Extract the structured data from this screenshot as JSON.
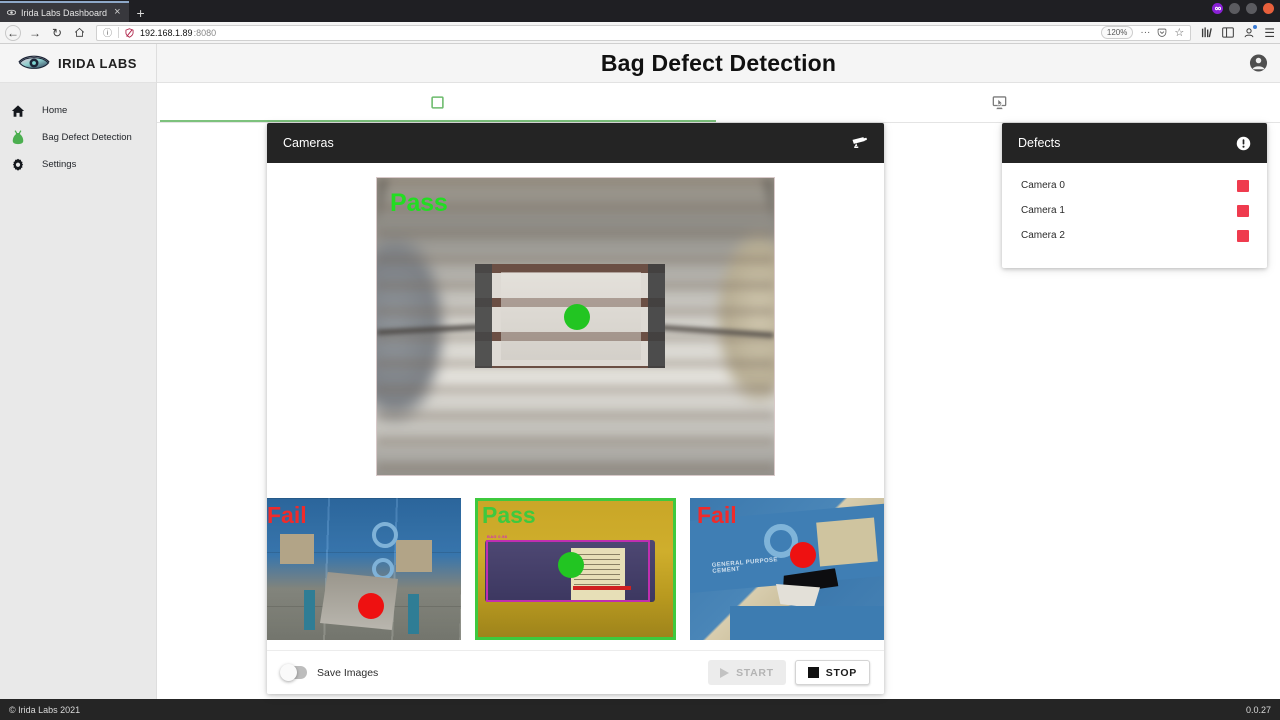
{
  "browser": {
    "tab": {
      "title": "Irida Labs Dashboard",
      "favicon": "irida-eye-favicon",
      "close": "×"
    },
    "new_tab_label": "+",
    "nav": {
      "back": "←",
      "forward": "→",
      "reload": "↻",
      "home": "⌂"
    },
    "url": {
      "host": "192.168.1.89",
      "port": ":8080",
      "shield": "ⓘ",
      "tracker": "tracking-protection-icon"
    },
    "zoom_level": "120%",
    "url_actions": {
      "more": "···",
      "pocket": "pocket-icon",
      "bookmark": "☆"
    },
    "toolbar_icons": {
      "library": "library-icon",
      "sidebar": "sidebar-icon",
      "account": "account-icon",
      "menu": "☰"
    },
    "window_controls": {
      "profile": "profile-avatar",
      "minimize": "minimize",
      "maximize": "maximize",
      "close": "close"
    }
  },
  "sidebar": {
    "brand": "IRIDA LABS",
    "items": [
      {
        "label": "Home",
        "icon": "home-icon"
      },
      {
        "label": "Bag Defect Detection",
        "icon": "bag-icon"
      },
      {
        "label": "Settings",
        "icon": "gear-icon"
      }
    ]
  },
  "header": {
    "title": "Bag Defect Detection",
    "account_icon": "account-circle-icon"
  },
  "tabs": [
    {
      "name": "cameras-tab",
      "icon": "monitor-square-icon",
      "active": true
    },
    {
      "name": "annotation-tab",
      "icon": "screen-pointer-icon",
      "active": false
    }
  ],
  "cameras_card": {
    "title": "Cameras",
    "header_icon": "security-camera-icon",
    "hero": {
      "verdict": "Pass",
      "verdict_color": "#22dd22",
      "marker_color": "#22c522",
      "caption": "conveyor-belt-bags-live-view"
    },
    "thumbnails": [
      {
        "verdict": "Fail",
        "verdict_color": "#ef2b2b",
        "marker_color": "#ee1111",
        "selected": false,
        "caption": "broken-cement-bag-pallet"
      },
      {
        "verdict": "Pass",
        "verdict_color": "#3ec93e",
        "marker_color": "#22c522",
        "selected": true,
        "caption": "labelled-bag-with-bbox"
      },
      {
        "verdict": "Fail",
        "verdict_color": "#ef2b2b",
        "marker_color": "#ee1111",
        "selected": false,
        "caption": "torn-general-purpose-cement-bag"
      }
    ],
    "footer": {
      "save_images_label": "Save Images",
      "save_images_on": false,
      "start_label": "START",
      "start_disabled": true,
      "stop_label": "STOP",
      "start_icon": "play-icon",
      "stop_icon": "stop-square-icon"
    }
  },
  "defects_card": {
    "title": "Defects",
    "header_icon": "alert-circle-icon",
    "rows": [
      {
        "label": "Camera 0",
        "status_color": "#ef3b4e"
      },
      {
        "label": "Camera 1",
        "status_color": "#ef3b4e"
      },
      {
        "label": "Camera 2",
        "status_color": "#ef3b4e"
      }
    ]
  },
  "footer": {
    "copyright": "© Irida Labs 2021",
    "version": "0.0.27"
  },
  "theme": {
    "accent_green": "#7dc27d",
    "dark_panel": "#242424",
    "sidebar_bg": "#e9e9e9"
  }
}
